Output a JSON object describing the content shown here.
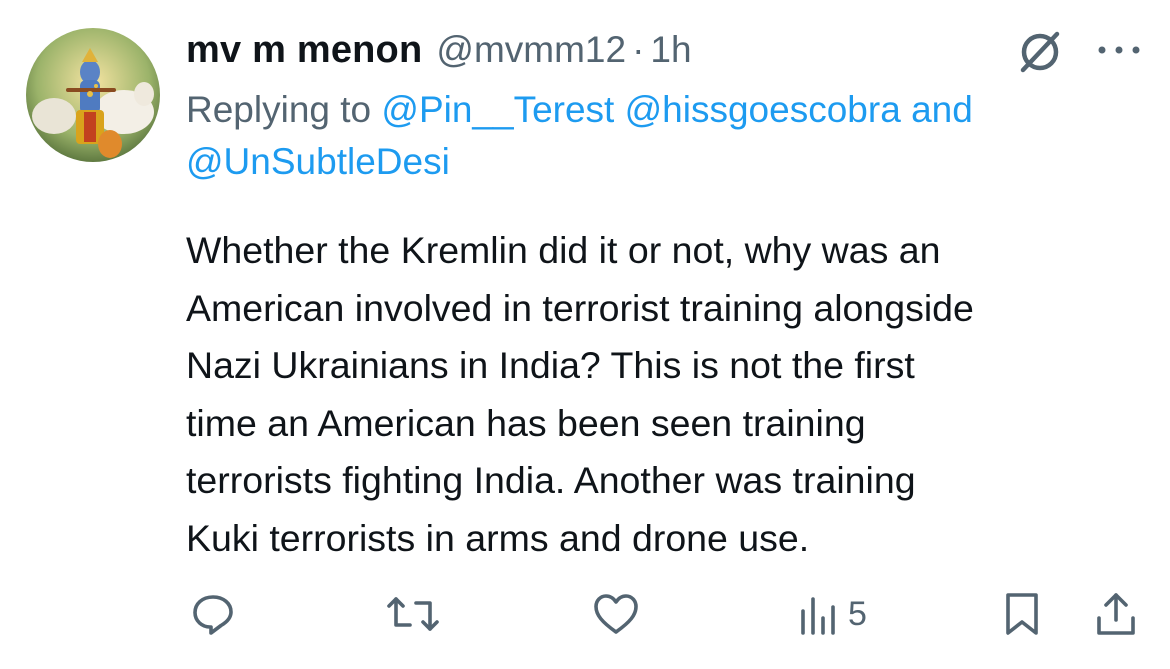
{
  "tweet": {
    "author": {
      "display_name": "mv m menon",
      "handle": "@mvmm12"
    },
    "separator": "·",
    "time": "1h",
    "replying_prefix": "Replying to",
    "replying_mentions": [
      "@Pin__Terest",
      "@hissgoescobra"
    ],
    "replying_joiner": "and",
    "replying_last_mention": "@UnSubtleDesi",
    "text": "Whether the Kremlin did it or not, why was an\nAmerican involved in terrorist training alongside\nNazi Ukrainians in India? This is not the first\ntime an American has been seen training\nterrorists fighting India. Another was training\nKuki terrorists in arms and drone use.",
    "views": "5"
  },
  "icons": {
    "grok": "grok-icon",
    "more": "more-icon",
    "reply": "reply-icon",
    "retweet": "retweet-icon",
    "like": "like-icon",
    "views": "views-icon",
    "bookmark": "bookmark-icon",
    "share": "share-icon"
  },
  "colors": {
    "text": "#0f1419",
    "secondary": "#536471",
    "link": "#1d9bf0"
  }
}
